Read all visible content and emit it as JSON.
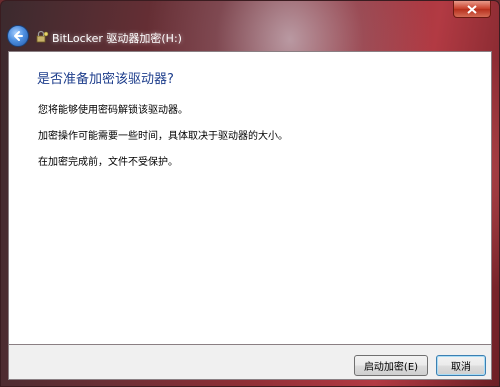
{
  "window": {
    "title": "BitLocker 驱动器加密(H:)"
  },
  "content": {
    "heading": "是否准备加密该驱动器?",
    "lines": [
      "您将能够使用密码解锁该驱动器。",
      "加密操作可能需要一些时间，具体取决于驱动器的大小。",
      "在加密完成前，文件不受保护。"
    ]
  },
  "footer": {
    "start_label": "启动加密(E)",
    "cancel_label": "取消"
  },
  "icons": {
    "close": "close-icon",
    "back": "back-arrow-icon",
    "bitlocker": "bitlocker-key-icon"
  },
  "colors": {
    "heading": "#1e3e8c",
    "close_button": "#c8402c"
  }
}
